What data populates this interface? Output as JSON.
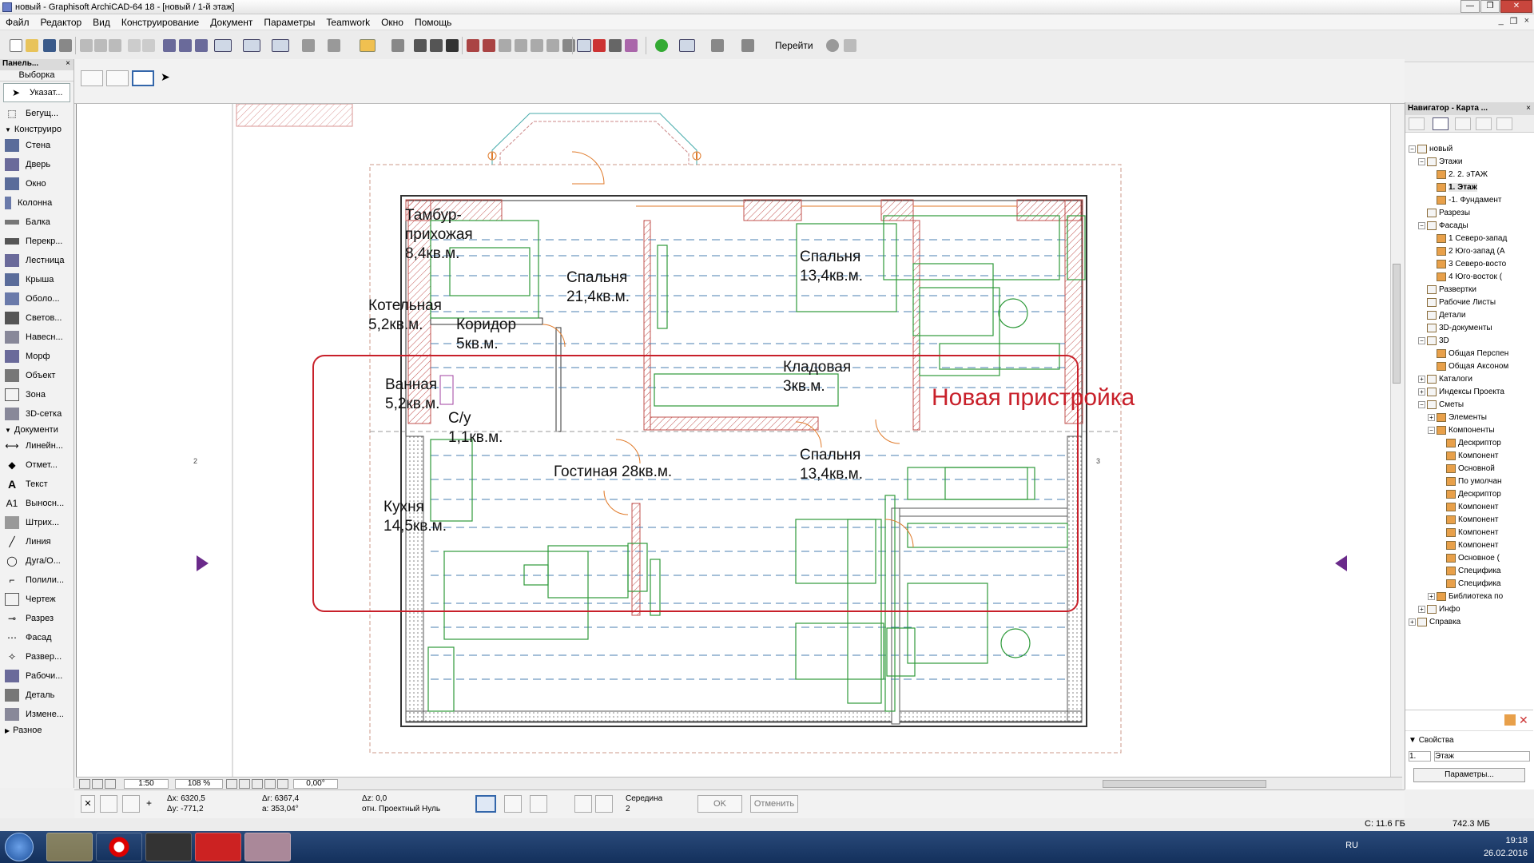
{
  "window": {
    "title": "новый - Graphisoft ArchiCAD-64 18 - [новый / 1-й этаж]",
    "minimize": "—",
    "maximize": "❐",
    "close": "✕"
  },
  "menu": [
    "Файл",
    "Редактор",
    "Вид",
    "Конструирование",
    "Документ",
    "Параметры",
    "Teamwork",
    "Окно",
    "Помощь"
  ],
  "menu_doc_controls": [
    "_",
    "❐",
    "×"
  ],
  "toolbar": {
    "goto_label": "Перейти"
  },
  "left_panel": {
    "title": "Панель...",
    "close": "×",
    "selection_label": "Выборка",
    "pointer_tool": "Указат...",
    "marquee_tool": "Бегущ...",
    "sections": {
      "design": "Конструиро",
      "document": "Документи",
      "more": "Разное"
    },
    "design_tools": [
      "Стена",
      "Дверь",
      "Окно",
      "Колонна",
      "Балка",
      "Перекр...",
      "Лестница",
      "Крыша",
      "Оболо...",
      "Светов...",
      "Навесн...",
      "Морф",
      "Объект",
      "Зона",
      "3D-сетка"
    ],
    "document_tools": [
      "Линейн...",
      "Отмет...",
      "Текст",
      "Выносн...",
      "Штрих...",
      "Линия",
      "Дуга/О...",
      "Полили...",
      "Чертеж",
      "Разрез",
      "Фасад",
      "Развер...",
      "Рабочи...",
      "Деталь",
      "Измене..."
    ]
  },
  "drawing": {
    "rooms": [
      {
        "name": "Тамбур-\nприхожая\n8,4кв.м."
      },
      {
        "name": "Котельная\n5,2кв.м."
      },
      {
        "name": "Коридор\n5кв.м."
      },
      {
        "name": "Спальня\n21,4кв.м."
      },
      {
        "name": "Спальня\n13,4кв.м."
      },
      {
        "name": "Ванная\n5,2кв.м."
      },
      {
        "name": "С/у\n1,1кв.м."
      },
      {
        "name": "Кладовая\n3кв.м."
      },
      {
        "name": "Гостиная 28кв.м."
      },
      {
        "name": "Спальня\n13,4кв.м."
      },
      {
        "name": "Кухня\n14,5кв.м."
      }
    ],
    "annotation": "Новая\nпристройка",
    "annotation_color": "#c8202a",
    "elevation_markers": [
      "2",
      "3"
    ]
  },
  "view_bar": {
    "scale": "1:50",
    "zoom": "108 %",
    "angle": "0,00°"
  },
  "coord_bar": {
    "dx": "Δx: 6320,5",
    "dy": "Δy: -771,2",
    "dr": "Δr: 6367,4",
    "a": "a: 353,04°",
    "dz": "Δz: 0,0",
    "ref": "отн. Проектный Нуль",
    "snap_label": "Середина",
    "snap_value": "2",
    "ok": "OK",
    "cancel": "Отменить"
  },
  "status": {
    "disk": "C: 11.6 ГБ",
    "memory": "742.3 МБ"
  },
  "navigator": {
    "title": "Навигатор - Карта ...",
    "close": "×",
    "tree": [
      {
        "label": "новый",
        "level": 0,
        "exp": "−"
      },
      {
        "label": "Этажи",
        "level": 1,
        "exp": "−"
      },
      {
        "label": "2. 2. эТАЖ",
        "level": 2,
        "exp": ""
      },
      {
        "label": "1. Этаж",
        "level": 2,
        "exp": "",
        "selected": true
      },
      {
        "label": "-1. Фундамент",
        "level": 2,
        "exp": ""
      },
      {
        "label": "Разрезы",
        "level": 1,
        "exp": ""
      },
      {
        "label": "Фасады",
        "level": 1,
        "exp": "−"
      },
      {
        "label": "1 Северо-запад",
        "level": 2,
        "exp": ""
      },
      {
        "label": "2 Юго-запад (А",
        "level": 2,
        "exp": ""
      },
      {
        "label": "3 Северо-восто",
        "level": 2,
        "exp": ""
      },
      {
        "label": "4 Юго-восток (",
        "level": 2,
        "exp": ""
      },
      {
        "label": "Развертки",
        "level": 1,
        "exp": ""
      },
      {
        "label": "Рабочие Листы",
        "level": 1,
        "exp": ""
      },
      {
        "label": "Детали",
        "level": 1,
        "exp": ""
      },
      {
        "label": "3D-документы",
        "level": 1,
        "exp": ""
      },
      {
        "label": "3D",
        "level": 1,
        "exp": "−"
      },
      {
        "label": "Общая Перспен",
        "level": 2,
        "exp": ""
      },
      {
        "label": "Общая Аксоном",
        "level": 2,
        "exp": ""
      },
      {
        "label": "Каталоги",
        "level": 1,
        "exp": "+"
      },
      {
        "label": "Индексы Проекта",
        "level": 1,
        "exp": "+"
      },
      {
        "label": "Сметы",
        "level": 1,
        "exp": "−"
      },
      {
        "label": "Элементы",
        "level": 2,
        "exp": "+"
      },
      {
        "label": "Компоненты",
        "level": 2,
        "exp": "−"
      },
      {
        "label": "Дескриптор",
        "level": 3,
        "exp": ""
      },
      {
        "label": "Компонент",
        "level": 3,
        "exp": ""
      },
      {
        "label": "Основной",
        "level": 3,
        "exp": ""
      },
      {
        "label": "По умолчан",
        "level": 3,
        "exp": ""
      },
      {
        "label": "Дескриптор",
        "level": 3,
        "exp": ""
      },
      {
        "label": "Компонент",
        "level": 3,
        "exp": ""
      },
      {
        "label": "Компонент",
        "level": 3,
        "exp": ""
      },
      {
        "label": "Компонент",
        "level": 3,
        "exp": ""
      },
      {
        "label": "Компонент",
        "level": 3,
        "exp": ""
      },
      {
        "label": "Основное (",
        "level": 3,
        "exp": ""
      },
      {
        "label": "Специфика",
        "level": 3,
        "exp": ""
      },
      {
        "label": "Специфика",
        "level": 3,
        "exp": ""
      },
      {
        "label": "Библиотека по",
        "level": 2,
        "exp": "+"
      },
      {
        "label": "Инфо",
        "level": 1,
        "exp": "+"
      },
      {
        "label": "Справка",
        "level": 0,
        "exp": "+"
      }
    ],
    "properties_label": "Свойства",
    "prop_id": "1.",
    "prop_value": "Этаж",
    "params_button": "Параметры..."
  },
  "taskbar": {
    "lang": "RU",
    "time": "19:18",
    "date": "26.02.2016"
  },
  "colors": {
    "wall_hatch": "#c0504d",
    "furniture": "#2e9a3a",
    "grid": "#4a7fb0",
    "annotation": "#c8202a"
  }
}
